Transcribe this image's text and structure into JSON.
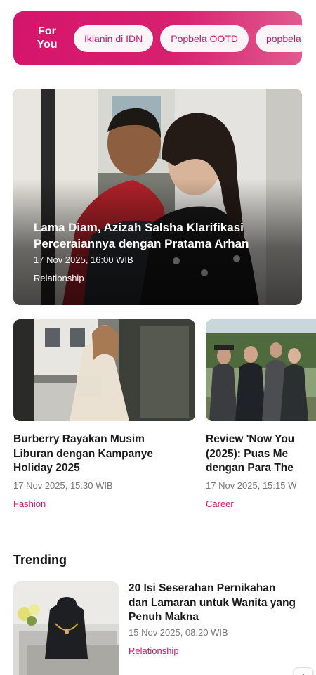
{
  "foryou": {
    "label_line1": "For",
    "label_line2": "You",
    "chips": [
      "Iklanin di IDN",
      "Popbela OOTD",
      "popbela"
    ]
  },
  "hero": {
    "title": "Lama Diam, Azizah Salsha Klarifikasi Perceraiannya dengan Pratama Arhan",
    "date": "17 Nov 2025, 16:00 WIB",
    "category": "Relationship"
  },
  "cards": [
    {
      "title_lines": [
        "Burberry Rayakan Musim",
        "Liburan dengan Kampanye",
        "Holiday 2025"
      ],
      "date": "17 Nov 2025, 15:30 WIB",
      "category": "Fashion"
    },
    {
      "title_lines": [
        "Review 'Now You",
        "(2025): Puas Me",
        "dengan Para The"
      ],
      "date": "17 Nov 2025, 15:15 W",
      "category": "Career"
    }
  ],
  "trending": {
    "section_title": "Trending",
    "item": {
      "title": "20 Isi Seserahan Pernikahan dan Lamaran untuk Wanita yang Penuh Makna",
      "date": "15 Nov 2025, 08:20 WIB",
      "category": "Relationship"
    }
  },
  "colors": {
    "accent": "#d5156b",
    "chip_bg": "#fdf4f7",
    "meta_text": "#777777"
  },
  "icons": {
    "scroll_top": "chevron-up-icon"
  }
}
